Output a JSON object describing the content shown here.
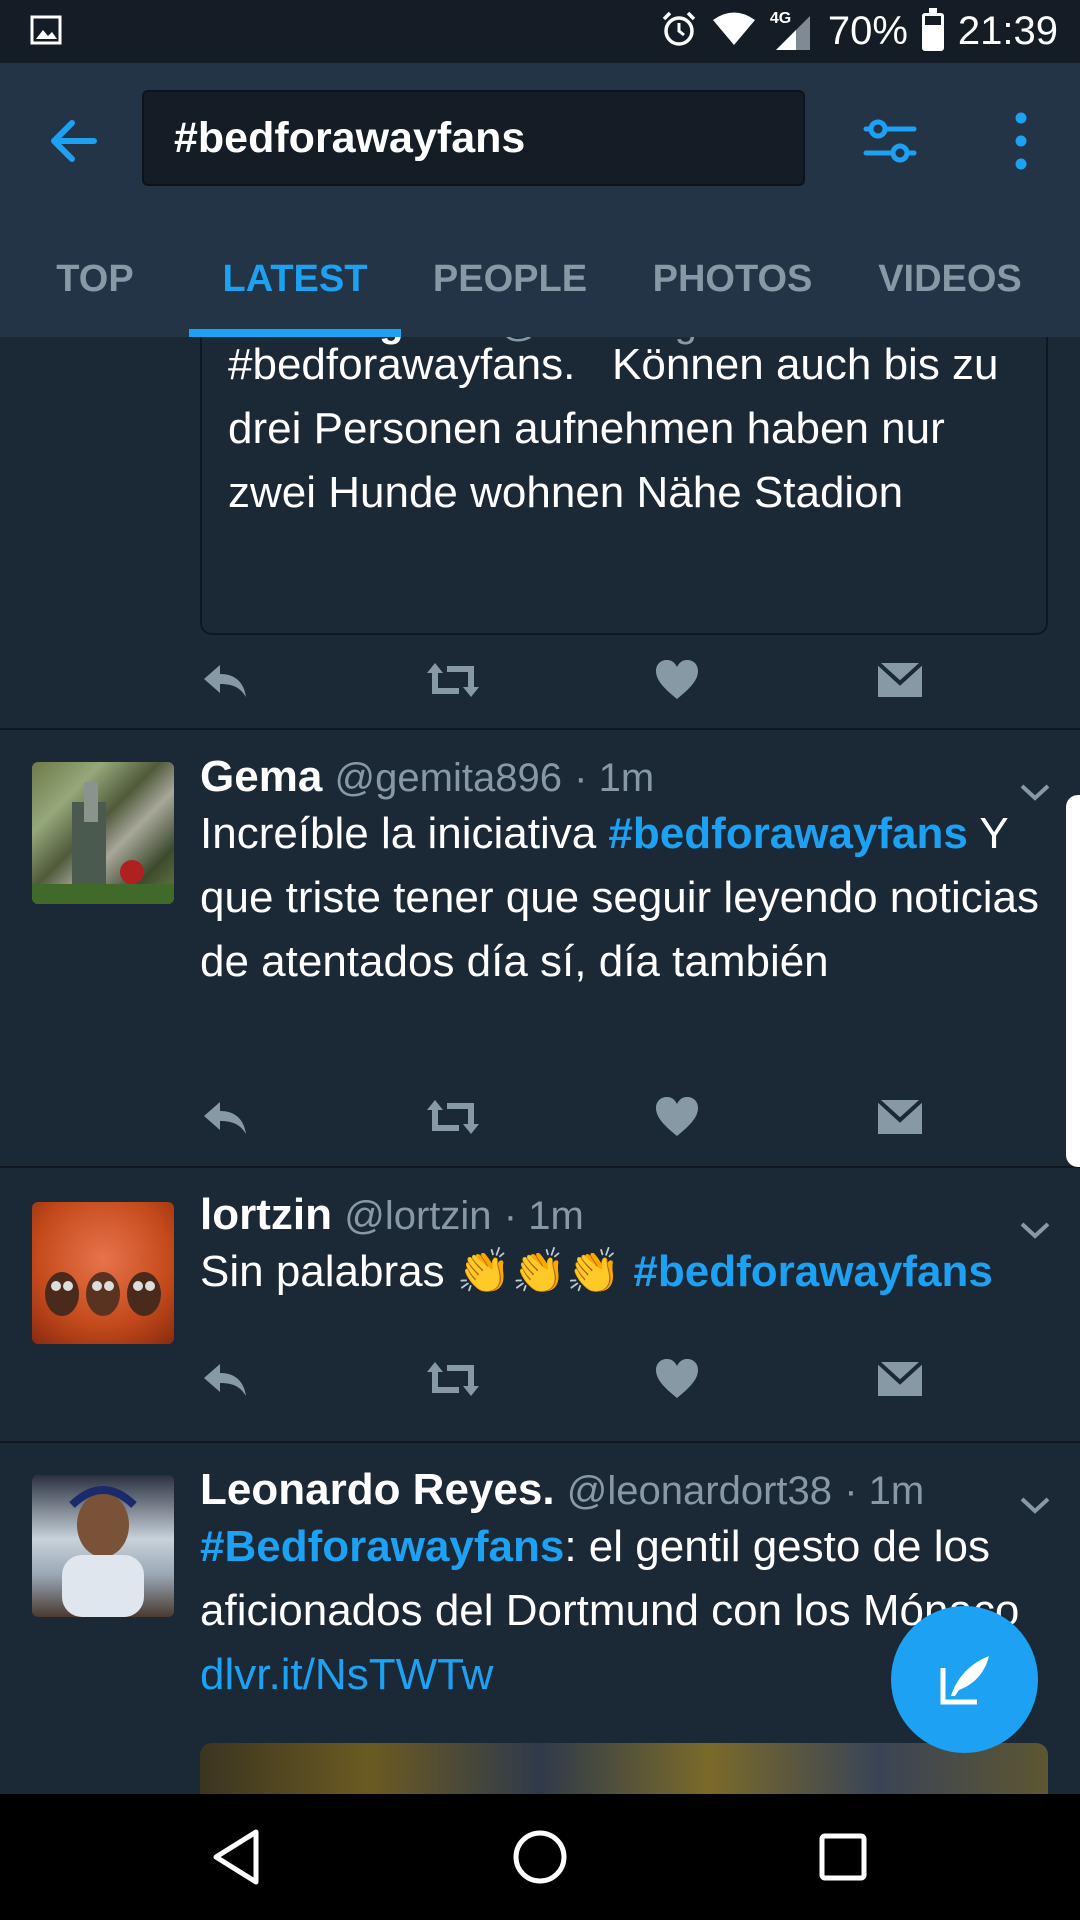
{
  "status_bar": {
    "network": "4G",
    "battery_percent": "70%",
    "battery_level": 0.7,
    "time": "21:39"
  },
  "app_bar": {
    "search_query": "#bedforawayfans",
    "tabs": [
      {
        "label": "TOP",
        "active": false
      },
      {
        "label": "LATEST",
        "active": true
      },
      {
        "label": "PEOPLE",
        "active": false
      },
      {
        "label": "PHOTOS",
        "active": false
      },
      {
        "label": "VIDEOS",
        "active": false
      }
    ]
  },
  "quoted_tweet": {
    "name": "Tine Wagener",
    "handle": "@TineWagener",
    "text_hashtag": "#bedforawayfans.",
    "text": "   Können auch bis zu drei Personen aufnehmen haben nur zwei Hunde wohnen Nähe Stadion"
  },
  "tweets": [
    {
      "name": "Gema",
      "handle": "@gemita896",
      "time": "· 1m",
      "text_before": "Increíble la iniciativa ",
      "hashtag": "#bedforawayfans",
      "text_after": " Y que triste tener que seguir leyendo noticias de atentados día sí, día también"
    },
    {
      "name": "lortzin",
      "handle": "@lortzin",
      "time": "· 1m",
      "text_before": "Sin palabras ",
      "emoji": "👏👏👏",
      "hashtag": "#bedforawayfans"
    },
    {
      "name": "Leonardo Reyes.",
      "handle": "@leonardort38",
      "time": "· 1m",
      "hashtag": "#Bedforawayfans",
      "text_after": ": el gentil gesto de los aficionados del Dortmund con los Mónaco ",
      "link": "dlvr.it/NsTWTw"
    }
  ],
  "colors": {
    "background": "#1b2836",
    "app_bar": "#243447",
    "accent": "#1da1f2",
    "secondary_text": "#8899a6"
  }
}
